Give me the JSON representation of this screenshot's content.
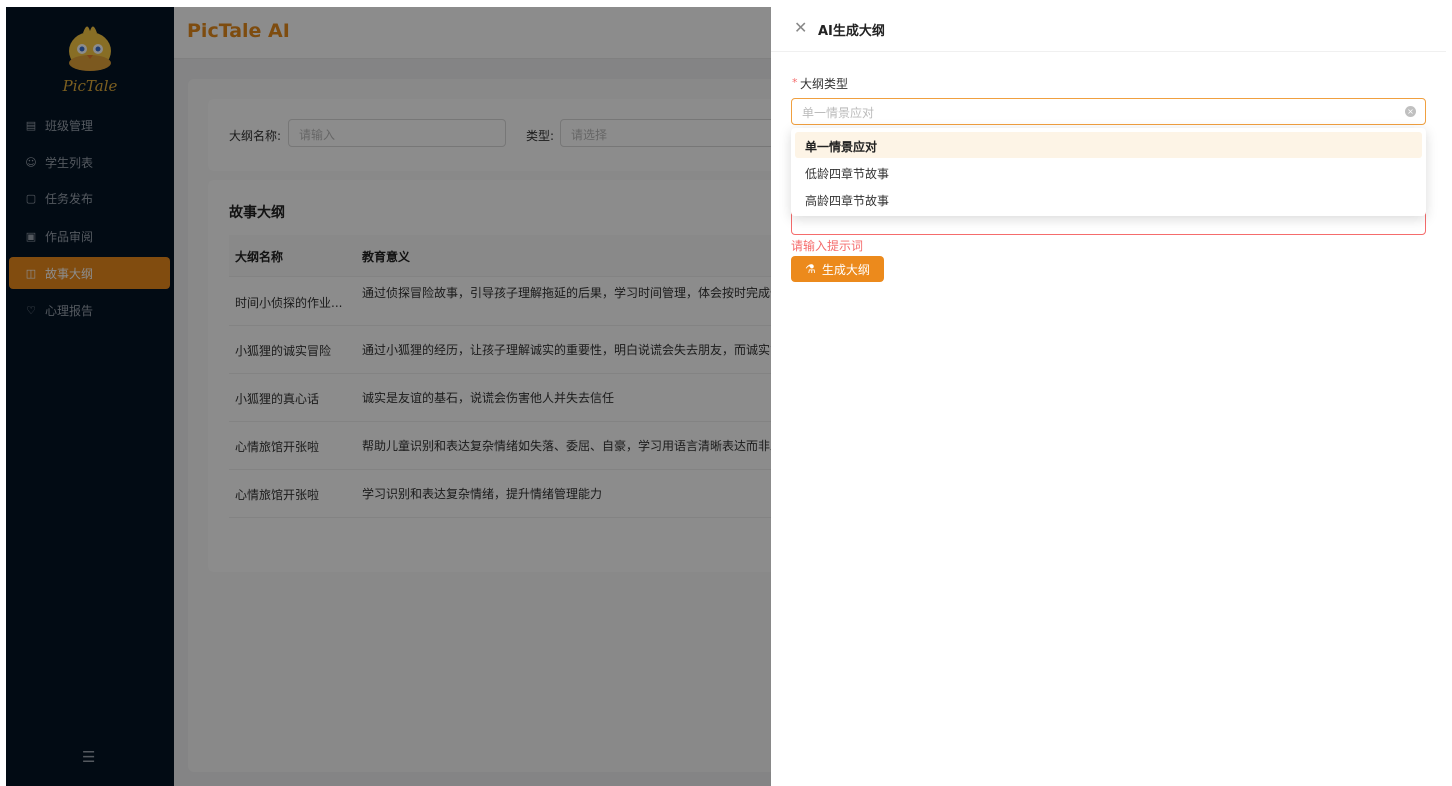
{
  "brand": {
    "logo_text": "PicTale",
    "app_title": "PicTale AI"
  },
  "sidebar": {
    "items": [
      {
        "label": "班级管理",
        "icon": "class-icon",
        "active": false
      },
      {
        "label": "学生列表",
        "icon": "student-icon",
        "active": false
      },
      {
        "label": "任务发布",
        "icon": "task-icon",
        "active": false
      },
      {
        "label": "作品审阅",
        "icon": "review-icon",
        "active": false
      },
      {
        "label": "故事大纲",
        "icon": "outline-icon",
        "active": true
      },
      {
        "label": "心理报告",
        "icon": "heart-icon",
        "active": false
      }
    ],
    "collapse_icon": "collapse-menu-icon"
  },
  "filter": {
    "name_label": "大纲名称:",
    "name_placeholder": "请输入",
    "type_label": "类型:",
    "type_placeholder": "请选择"
  },
  "table": {
    "title": "故事大纲",
    "headers": [
      "大纲名称",
      "教育意义"
    ],
    "rows": [
      {
        "name": "时间小侦探的作业...",
        "meaning": "通过侦探冒险故事，引导孩子理解拖延的后果，学习时间管理，体会按时完成作业的轻松感。"
      },
      {
        "name": "小狐狸的诚实冒险",
        "meaning": "通过小狐狸的经历，让孩子理解诚实的重要性，明白说谎会失去朋友，而诚实能"
      },
      {
        "name": "小狐狸的真心话",
        "meaning": "诚实是友谊的基石，说谎会伤害他人并失去信任"
      },
      {
        "name": "心情旅馆开张啦",
        "meaning": "帮助儿童识别和表达复杂情绪如失落、委屈、自豪，学习用语言清晰表达而非发"
      },
      {
        "name": "心情旅馆开张啦",
        "meaning": "学习识别和表达复杂情绪，提升情绪管理能力"
      }
    ]
  },
  "drawer": {
    "title": "AI生成大纲",
    "field_label": "大纲类型",
    "required_mark": "*",
    "select_placeholder": "单一情景应对",
    "options": [
      "单一情景应对",
      "低龄四章节故事",
      "高龄四章节故事"
    ],
    "selected_option": "单一情景应对",
    "error_text": "请输入提示词",
    "generate_button": "生成大纲"
  },
  "colors": {
    "accent": "#ec8a1c",
    "sidebar_bg": "#041426",
    "error": "#f56c6c"
  }
}
